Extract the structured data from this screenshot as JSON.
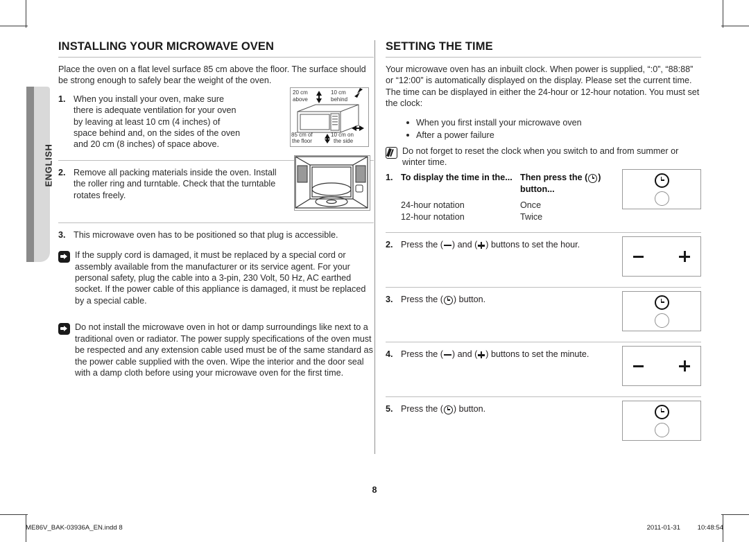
{
  "lang_tab": {
    "label": "ENGLISH"
  },
  "left": {
    "title": "INSTALLING YOUR MICROWAVE OVEN",
    "intro": "Place the oven on a flat level surface 85 cm above the floor. The surface should be strong enough to safely bear the weight of the oven.",
    "steps": [
      {
        "num": "1.",
        "text": "When you install your oven, make sure there is adequate ventilation for your oven by leaving at least 10 cm (4 inches) of space behind and, on the sides of the oven and 20 cm (8 inches) of space above."
      },
      {
        "num": "2.",
        "text": "Remove all packing materials inside the oven. Install the roller ring and turntable. Check that the turntable rotates freely."
      },
      {
        "num": "3.",
        "text": "This microwave oven has to be positioned so that plug is accessible."
      }
    ],
    "notes": [
      {
        "icon": "pointing-hand-icon",
        "text": "If the supply cord is damaged, it must be replaced by a special cord or assembly available from the manufacturer or its service agent. For your personal safety, plug the cable into a 3-pin, 230 Volt, 50 Hz, AC earthed socket. If the power cable of this appliance is damaged, it must be replaced by a special cable."
      },
      {
        "icon": "pointing-hand-icon",
        "text": "Do not install the microwave oven in hot or damp surroundings like next to a traditional oven or radiator. The power supply specifications of the oven must be respected and any extension cable used must be of the same standard as the power cable supplied with the oven. Wipe the interior and the door seal with a damp cloth before using your microwave oven for the first time."
      }
    ],
    "illustration_1": {
      "name": "oven-clearance-diagram",
      "labels": {
        "top_left": "20 cm",
        "top_left_2": "above",
        "top_right": "10 cm",
        "top_right_2": "behind",
        "bottom_left": "85 cm of",
        "bottom_left_2": "the floor",
        "bottom_right": "10 cm on",
        "bottom_right_2": "the side"
      }
    },
    "illustration_2": {
      "name": "oven-interior-turntable-diagram"
    }
  },
  "right": {
    "title": "SETTING THE TIME",
    "intro": "Your microwave oven has an inbuilt clock. When power is supplied, “:0”, “88:88” or “12:00” is automatically displayed on the display. Please set the current time. The time can be displayed in either the 24-hour or 12-hour notation. You must set the clock:",
    "bullets": [
      "When you first install your microwave oven",
      "After a power failure"
    ],
    "note": {
      "icon": "note-pencil-icon",
      "text": "Do not forget to reset the clock when you switch to and from summer or winter time."
    },
    "steps": [
      {
        "num": "1.",
        "table": {
          "headers": [
            "To display the time in the...",
            "Then press the (clock) button..."
          ],
          "header_col1": "To display the time in the...",
          "header_col2_pre": "Then press the (",
          "header_col2_post": ") button...",
          "rows": [
            [
              "24-hour notation",
              "Once"
            ],
            [
              "12-hour notation",
              "Twice"
            ]
          ]
        },
        "button_panel": "clock-and-circle-buttons"
      },
      {
        "num": "2.",
        "text_pre": "Press the (",
        "text_mid": ") and (",
        "text_post": ") buttons to set the hour.",
        "button_panel": "minus-plus-buttons"
      },
      {
        "num": "3.",
        "text_pre": "Press the (",
        "text_post": ") button.",
        "button_panel": "clock-and-circle-buttons"
      },
      {
        "num": "4.",
        "text_pre": "Press the (",
        "text_mid": ") and (",
        "text_post": ") buttons to set the minute.",
        "button_panel": "minus-plus-buttons"
      },
      {
        "num": "5.",
        "text_pre": "Press the (",
        "text_post": ") button.",
        "button_panel": "clock-and-circle-buttons"
      }
    ]
  },
  "page_number": "8",
  "footer": {
    "file": "ME86V_BAK-03936A_EN.indd   8",
    "date": "2011-01-31",
    "time": "10:48:54"
  }
}
